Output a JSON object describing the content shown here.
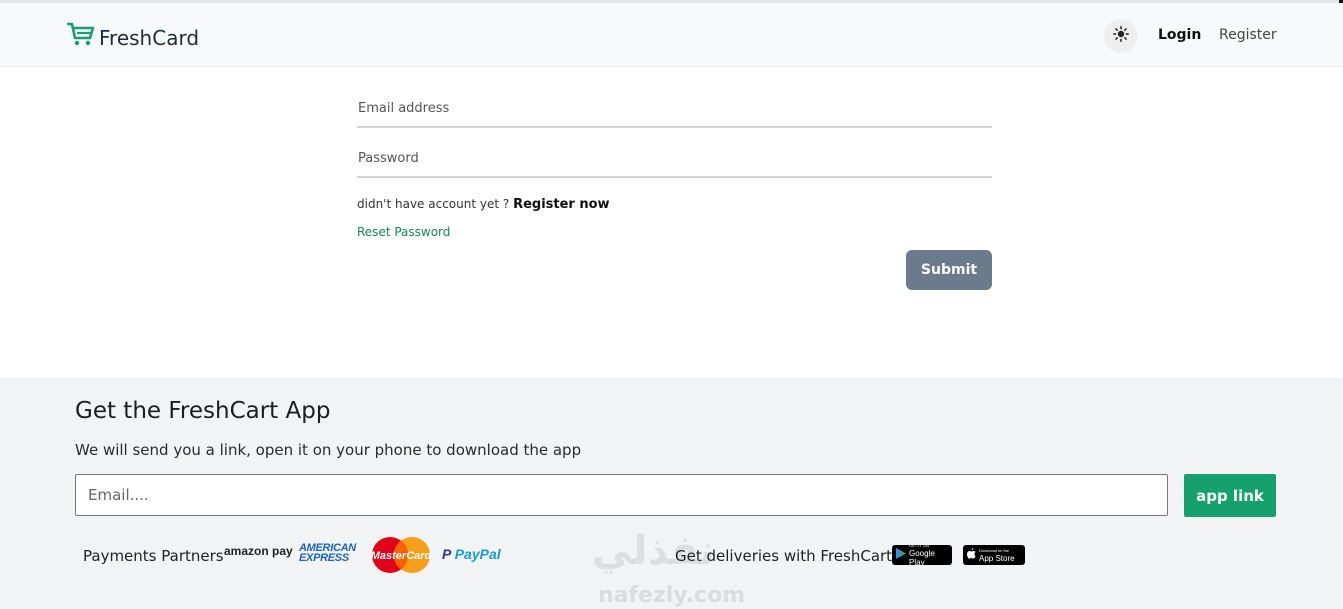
{
  "brand": {
    "name": "FreshCard"
  },
  "nav": {
    "login": "Login",
    "register": "Register",
    "theme_icon": "sun-icon"
  },
  "form": {
    "email_placeholder": "Email address",
    "password_placeholder": "Password",
    "no_account_text": "didn't have account yet ? ",
    "register_now": "Register now",
    "reset_password": "Reset Password",
    "submit": "Submit"
  },
  "footer": {
    "title": "Get the FreshCart App",
    "subtitle": "We will send you a link, open it on your phone to download the app",
    "email_placeholder": "Email....",
    "app_link": "app link",
    "payments_label": "Payments Partners",
    "partners": [
      "amazon pay",
      "AMERICAN EXPRESS",
      "MasterCard",
      "PayPal"
    ],
    "deliveries_label": "Get deliveries with FreshCart",
    "stores": [
      {
        "small": "GET IT ON",
        "big": "Google Play"
      },
      {
        "small": "Download on the",
        "big": "App Store"
      }
    ],
    "watermark": "نفذلي",
    "watermark_url": "nafezly.com"
  },
  "colors": {
    "accent": "#16a06d",
    "submit_bg": "#6c7a8d",
    "footer_bg": "#f2f3f5",
    "nav_bg": "#f8f9fa"
  }
}
